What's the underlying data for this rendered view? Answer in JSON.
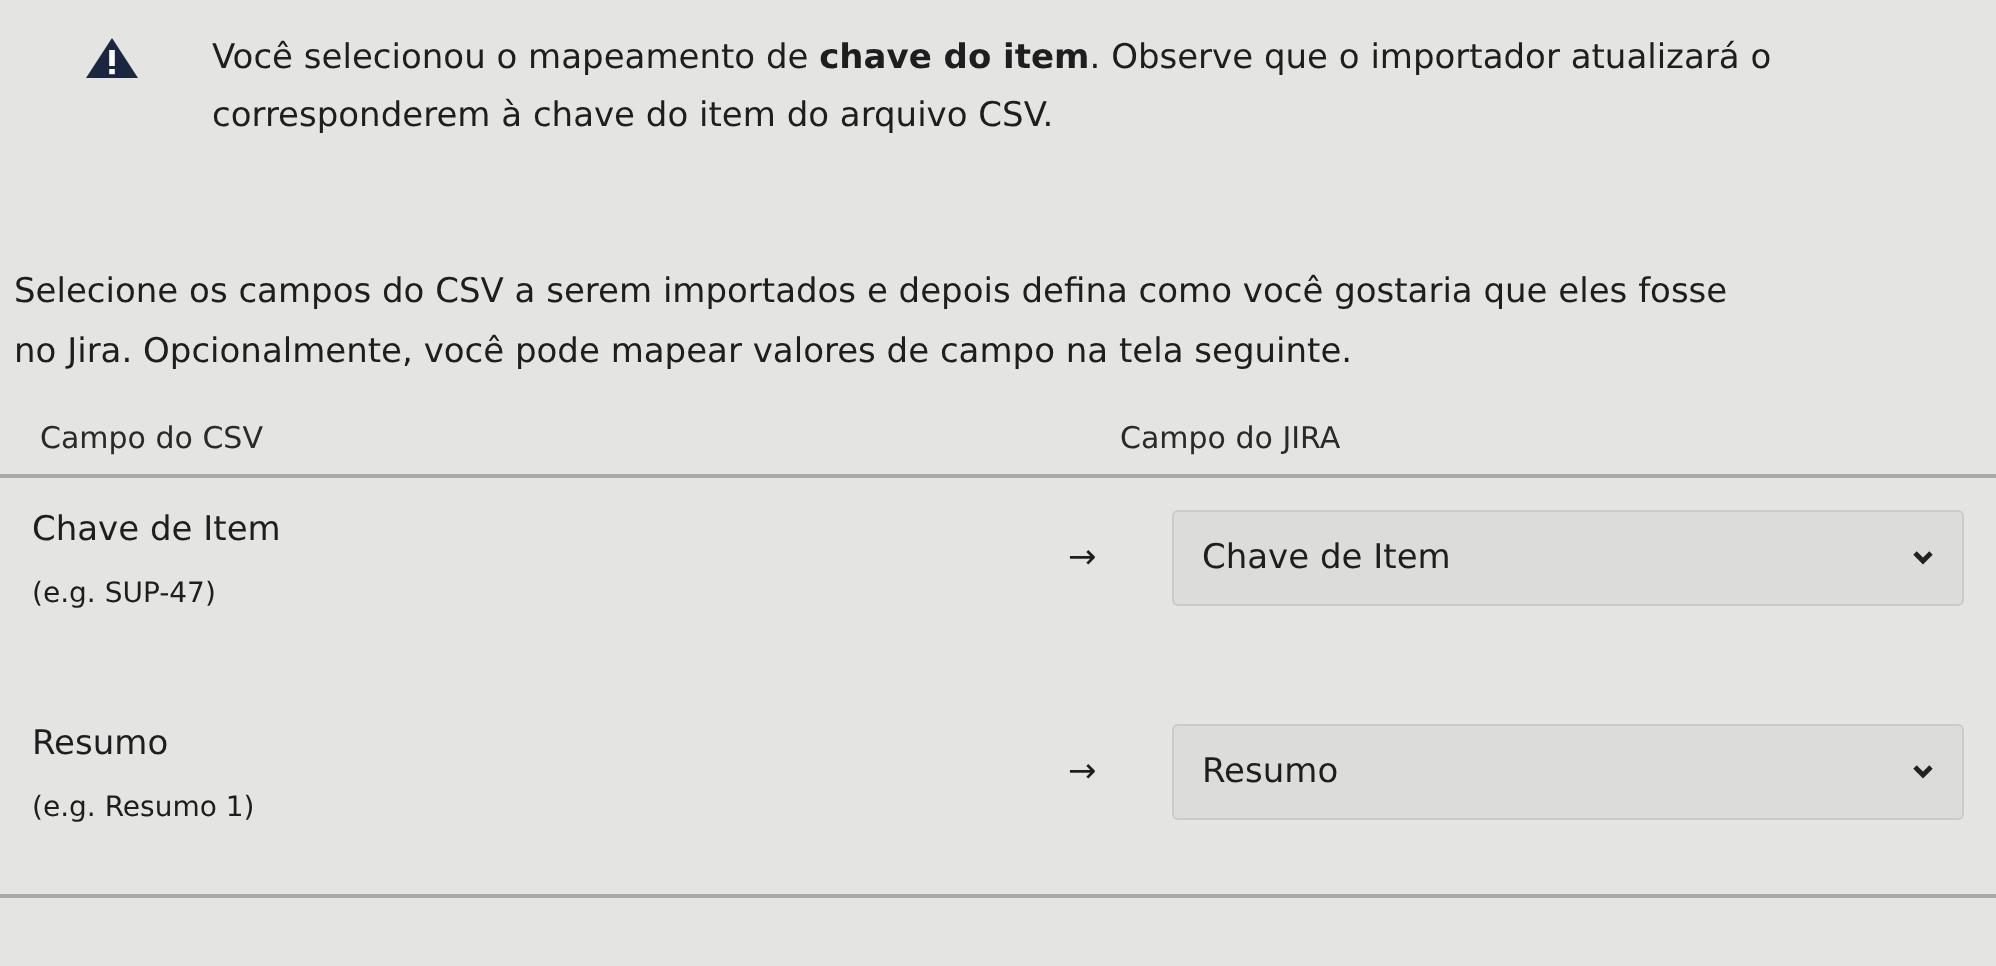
{
  "warning": {
    "text": "Você selecionou o mapeamento de **chave do item**. Observe que o importador atualizará o",
    "text_line_2": "corresponderem à chave do item do arquivo CSV."
  },
  "intro": [
    "Selecione os campos do CSV a serem importados e depois defina como você gostaria que eles fosse",
    "no Jira. Opcionalmente, você pode mapear valores de campo na tela seguinte."
  ],
  "table": {
    "columns": [
      "Campo do CSV",
      "Campo do JIRA"
    ],
    "rows": [
      {
        "csv_field": "Chave de Item",
        "example": "(e.g. SUP-47)",
        "arrow": "→",
        "jira_field": "Chave de Item"
      },
      {
        "csv_field": "Resumo",
        "example": "(e.g. Resumo 1)",
        "arrow": "→",
        "jira_field": "Resumo"
      }
    ]
  }
}
